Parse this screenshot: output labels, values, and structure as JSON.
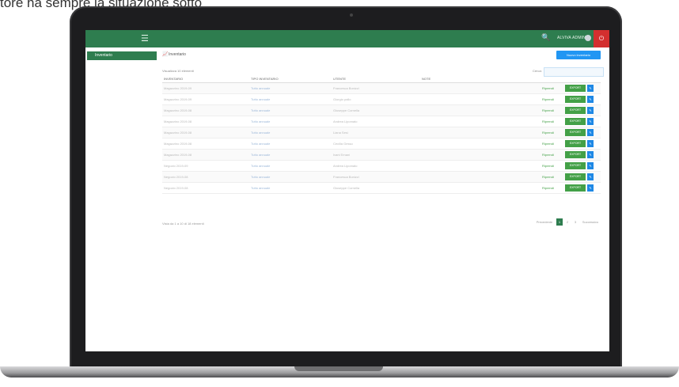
{
  "caption": "tore ha sempre la situazione sotto",
  "app": {
    "user_name": "ALVIVA ADMINO",
    "logout_icon": "power-icon",
    "sidebar": {
      "items": [
        {
          "label": "Inventario",
          "active": true
        }
      ]
    },
    "main": {
      "title": "Inventario",
      "add_button": "Nuovo inventario",
      "show_label": "Visualizza 10 elementi",
      "search_label": "Cerca:",
      "search_placeholder": "",
      "columns": [
        "INVENTARIO",
        "TIPO INVENTARIO",
        "UTENTE",
        "NOTE"
      ],
      "rows": [
        {
          "inventario": "Magazzino 2019-09",
          "tipo": "Tutto annuale",
          "utente": "Francesca Bonizzi",
          "action_link": "Riprendi",
          "export": "EXPORT"
        },
        {
          "inventario": "Magazzino 2019-09",
          "tipo": "Tutto annuale",
          "utente": "Giorgio pallo",
          "action_link": "Riprendi",
          "export": "EXPORT"
        },
        {
          "inventario": "Magazzino 2019-08",
          "tipo": "Tutto annuale",
          "utente": "Giuseppe Cornella",
          "action_link": "Riprendi",
          "export": "EXPORT"
        },
        {
          "inventario": "Magazzino 2019-08",
          "tipo": "Tutto annuale",
          "utente": "Andrea Lipomato",
          "action_link": "Riprendi",
          "export": "EXPORT"
        },
        {
          "inventario": "Magazzino 2019-08",
          "tipo": "Tutto annuale",
          "utente": "Liana Sesi",
          "action_link": "Riprendi",
          "export": "EXPORT"
        },
        {
          "inventario": "Magazzino 2019-08",
          "tipo": "Tutto annuale",
          "utente": "Cecilia Gesso",
          "action_link": "Riprendi",
          "export": "EXPORT"
        },
        {
          "inventario": "Magazzino 2019-08",
          "tipo": "Tutto annuale",
          "utente": "Ivani Ernani",
          "action_link": "Riprendi",
          "export": "EXPORT"
        },
        {
          "inventario": "Negozio 2019-09",
          "tipo": "Tutto annuale",
          "utente": "Andrea Lipomato",
          "action_link": "Riprendi",
          "export": "EXPORT"
        },
        {
          "inventario": "Negozio 2019-08",
          "tipo": "Tutto annuale",
          "utente": "Francesca Bonizzi",
          "action_link": "Riprendi",
          "export": "EXPORT"
        },
        {
          "inventario": "Negozio 2019-08",
          "tipo": "Tutto annuale",
          "utente": "Giuseppe Cornella",
          "action_link": "Riprendi",
          "export": "EXPORT"
        }
      ],
      "footer_info": "Vista da 1 a 10 di 18 elementi",
      "pager": {
        "prev": "Precedente",
        "pages": [
          "1",
          "2",
          "3"
        ],
        "next": "Successivo"
      }
    }
  },
  "colors": {
    "topbar": "#2e7d4f",
    "logout": "#d32f2f",
    "primary": "#2196f3",
    "success": "#43a047"
  }
}
